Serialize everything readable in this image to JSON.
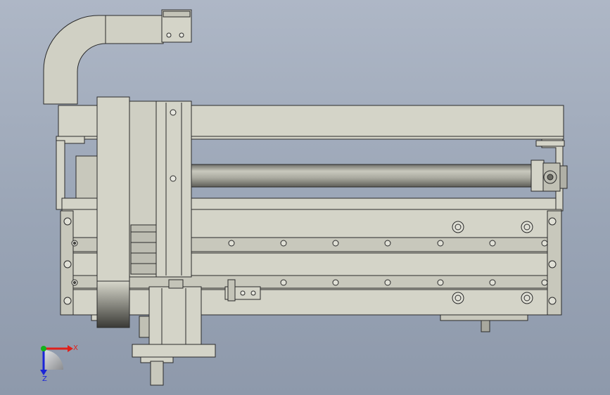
{
  "viewport": {
    "background_top": "#aeb7c6",
    "background_bottom": "#8e99ab"
  },
  "model": {
    "body_color": "#d4d4c8",
    "shade_color": "#c4c4b8",
    "outline_color": "#2a2a2a",
    "rod_color": "#b8b8ae",
    "bolt_color": "#8a8a80"
  },
  "triad": {
    "x_label": "X",
    "z_label": "Z",
    "x_color": "#e0201a",
    "y_color": "#12b31a",
    "z_color": "#1a24d8"
  }
}
